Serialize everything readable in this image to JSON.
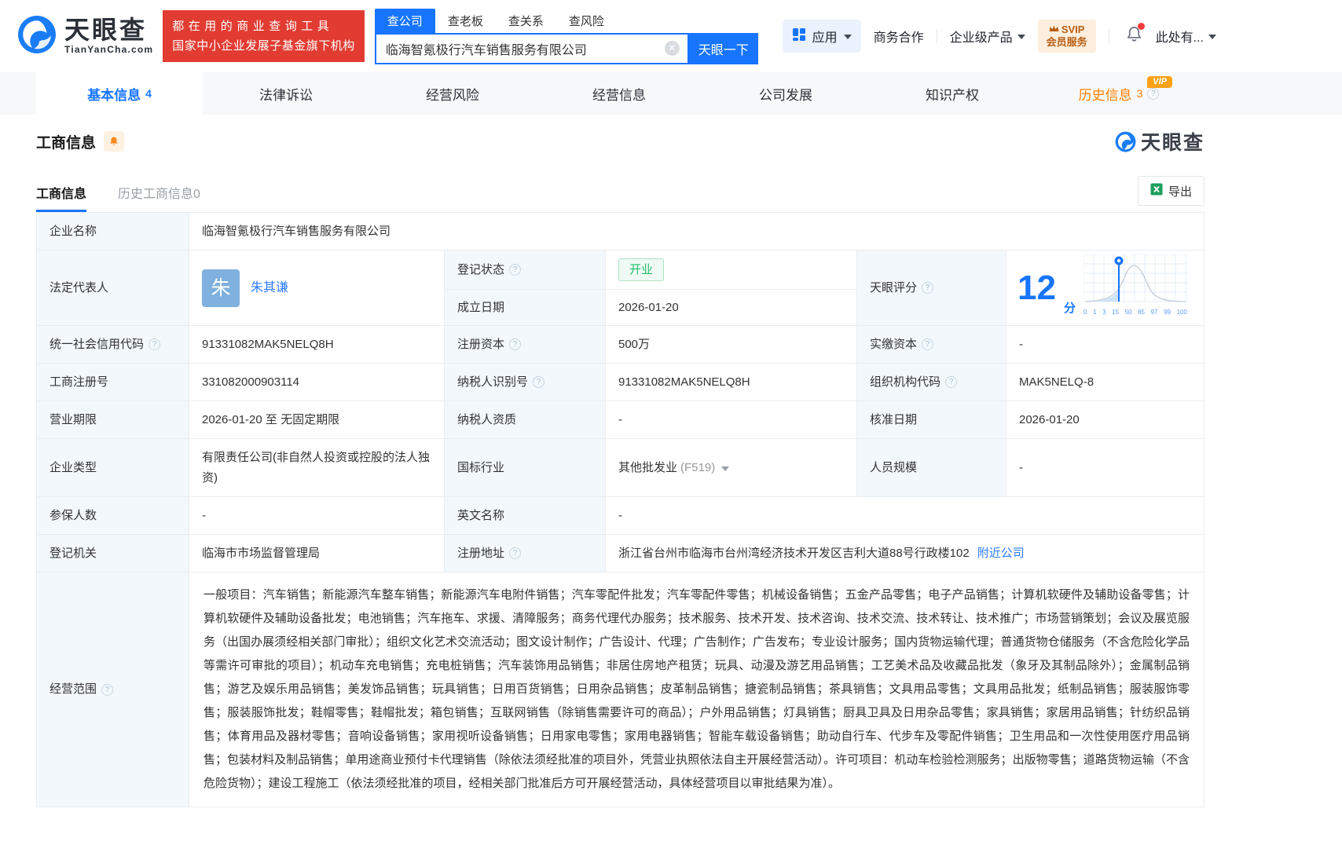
{
  "header": {
    "brand": "天眼查",
    "brand_domain": "TianYanCha.com",
    "slogan_line1": "都在用的商业查询工具",
    "slogan_line2": "国家中小企业发展子基金旗下机构",
    "search_tabs": [
      {
        "label": "查公司"
      },
      {
        "label": "查老板"
      },
      {
        "label": "查关系"
      },
      {
        "label": "查风险"
      }
    ],
    "search_value": "临海智氪极行汽车销售服务有限公司",
    "search_button": "天眼一下",
    "apps_label": "应用",
    "biz_coop": "商务合作",
    "enterprise_products": "企业级产品",
    "svip_line1": "SVIP",
    "svip_line2": "会员服务",
    "more_label": "此处有..."
  },
  "tabs": [
    {
      "label": "基本信息",
      "count": "4"
    },
    {
      "label": "法律诉讼"
    },
    {
      "label": "经营风险"
    },
    {
      "label": "经营信息"
    },
    {
      "label": "公司发展"
    },
    {
      "label": "知识产权"
    },
    {
      "label": "历史信息",
      "count": "3",
      "badge": "VIP"
    }
  ],
  "section": {
    "title": "工商信息",
    "watermark_brand": "天眼查",
    "subtab_active": "工商信息",
    "subtab_history": "历史工商信息0",
    "export_label": "导出"
  },
  "table": {
    "company_name_label": "企业名称",
    "company_name": "临海智氪极行汽车销售服务有限公司",
    "legal_rep_label": "法定代表人",
    "legal_rep_avatar": "朱",
    "legal_rep_name": "朱其谦",
    "reg_status_label": "登记状态",
    "reg_status": "开业",
    "establish_date_label": "成立日期",
    "establish_date": "2026-01-20",
    "score_label": "天眼评分",
    "score_value": "12",
    "score_unit": "分",
    "score_axis": [
      "0",
      "1",
      "3",
      "15",
      "50",
      "85",
      "97",
      "99",
      "100"
    ],
    "credit_code_label": "统一社会信用代码",
    "credit_code": "91331082MAK5NELQ8H",
    "reg_capital_label": "注册资本",
    "reg_capital": "500万",
    "paid_capital_label": "实缴资本",
    "paid_capital": "-",
    "reg_number_label": "工商注册号",
    "reg_number": "331082000903114",
    "taxpayer_id_label": "纳税人识别号",
    "taxpayer_id": "91331082MAK5NELQ8H",
    "org_code_label": "组织机构代码",
    "org_code": "MAK5NELQ-8",
    "term_label": "营业期限",
    "term": "2026-01-20 至 无固定期限",
    "taxpayer_quality_label": "纳税人资质",
    "taxpayer_quality": "-",
    "approval_date_label": "核准日期",
    "approval_date": "2026-01-20",
    "company_type_label": "企业类型",
    "company_type": "有限责任公司(非自然人投资或控股的法人独资)",
    "industry_label": "国标行业",
    "industry": "其他批发业",
    "industry_code": "(F519)",
    "staff_label": "人员规模",
    "staff": "-",
    "insured_label": "参保人数",
    "insured": "-",
    "english_name_label": "英文名称",
    "english_name": "-",
    "authority_label": "登记机关",
    "authority": "临海市市场监督管理局",
    "address_label": "注册地址",
    "address": "浙江省台州市临海市台州湾经济技术开发区吉利大道88号行政楼102",
    "nearby_link": "附近公司",
    "scope_label": "经营范围",
    "scope": "一般项目：汽车销售；新能源汽车整车销售；新能源汽车电附件销售；汽车零配件批发；汽车零配件零售；机械设备销售；五金产品零售；电子产品销售；计算机软硬件及辅助设备零售；计算机软硬件及辅助设备批发；电池销售；汽车拖车、求援、清障服务；商务代理代办服务；技术服务、技术开发、技术咨询、技术交流、技术转让、技术推广；市场营销策划；会议及展览服务（出国办展须经相关部门审批）；组织文化艺术交流活动；图文设计制作；广告设计、代理；广告制作；广告发布；专业设计服务；国内货物运输代理；普通货物仓储服务（不含危险化学品等需许可审批的项目）；机动车充电销售；充电桩销售；汽车装饰用品销售；非居住房地产租赁；玩具、动漫及游艺用品销售；工艺美术品及收藏品批发（象牙及其制品除外）；金属制品销售；游艺及娱乐用品销售；美发饰品销售；玩具销售；日用百货销售；日用杂品销售；皮革制品销售；搪瓷制品销售；茶具销售；文具用品零售；文具用品批发；纸制品销售；服装服饰零售；服装服饰批发；鞋帽零售；鞋帽批发；箱包销售；互联网销售（除销售需要许可的商品）；户外用品销售；灯具销售；厨具卫具及日用杂品零售；家具销售；家居用品销售；针纺织品销售；体育用品及器材零售；音响设备销售；家用视听设备销售；日用家电零售；家用电器销售；智能车载设备销售；助动自行车、代步车及零配件销售；卫生用品和一次性使用医疗用品销售；包装材料及制品销售；单用途商业预付卡代理销售（除依法须经批准的项目外，凭营业执照依法自主开展经营活动）。许可项目：机动车检验检测服务；出版物零售；道路货物运输（不含危险货物）；建设工程施工（依法须经批准的项目，经相关部门批准后方可开展经营活动，具体经营项目以审批结果为准）。"
  },
  "colors": {
    "accent_blue": "#1775ff",
    "status_green": "#26bf71",
    "history_orange": "#ff7e00",
    "brand_red": "#e23c32"
  }
}
